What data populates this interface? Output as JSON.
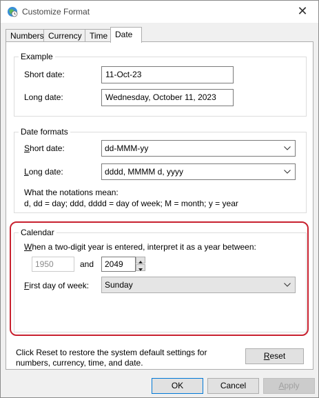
{
  "window": {
    "title": "Customize Format",
    "close_label": "✕"
  },
  "tabs": [
    {
      "label": "Numbers",
      "active": false
    },
    {
      "label": "Currency",
      "active": false
    },
    {
      "label": "Time",
      "active": false
    },
    {
      "label": "Date",
      "active": true
    }
  ],
  "example": {
    "legend": "Example",
    "short_label": "Short date:",
    "short_value": "11-Oct-23",
    "long_label": "Long date:",
    "long_value": "Wednesday, October 11, 2023"
  },
  "date_formats": {
    "legend": "Date formats",
    "short_label_access": "S",
    "short_label_rest": "hort date:",
    "short_value": "dd-MMM-yy",
    "long_label_access": "L",
    "long_label_rest": "ong date:",
    "long_value": "dddd, MMMM d, yyyy",
    "notation_title": "What the notations mean:",
    "notation_text": "d, dd = day;  ddd, dddd = day of week;  M = month;  y = year"
  },
  "calendar": {
    "legend": "Calendar",
    "two_digit_pre": "W",
    "two_digit_rest": "hen a two-digit year is entered, interpret it as a year between:",
    "year_from": "1950",
    "and_label": "and",
    "year_to": "2049",
    "first_day_access": "F",
    "first_day_rest": "irst day of week:",
    "first_day_value": "Sunday"
  },
  "footer": {
    "reset_note": "Click Reset to restore the system default settings for numbers, currency, time, and date.",
    "reset_access": "R",
    "reset_rest": "eset"
  },
  "buttons": {
    "ok": "OK",
    "cancel": "Cancel",
    "apply_access": "A",
    "apply_rest": "pply"
  },
  "colors": {
    "highlight": "#c8202e",
    "focus_border": "#0078d7"
  },
  "icons": {
    "app": "globe-clock-icon",
    "close": "close-icon",
    "dropdown": "chevron-down-icon",
    "spin_up": "caret-up-icon",
    "spin_down": "caret-down-icon"
  }
}
